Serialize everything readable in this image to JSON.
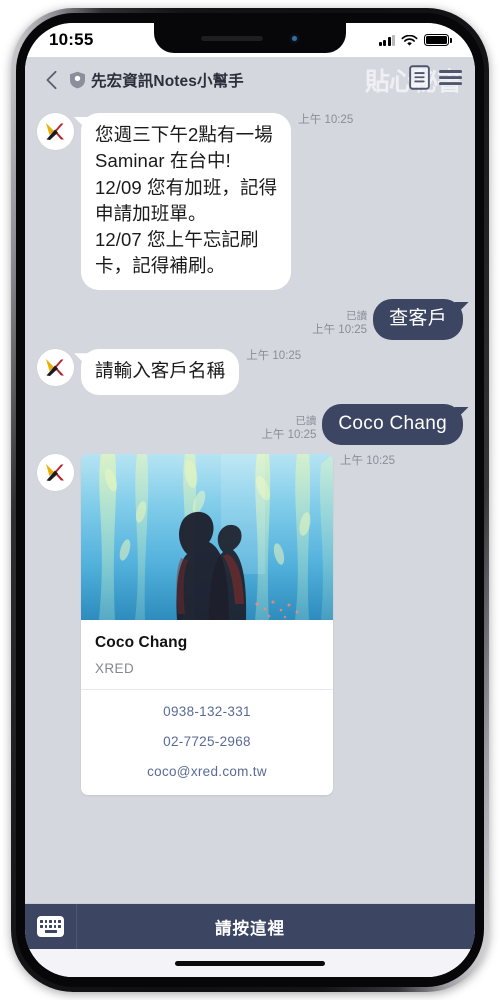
{
  "status_bar": {
    "time": "10:55",
    "signal_icon": "signal-bars-icon",
    "wifi_icon": "wifi-icon",
    "battery_icon": "battery-full-icon"
  },
  "header": {
    "back_icon": "chevron-left-icon",
    "verified_icon": "shield-check-icon",
    "title": "先宏資訊Notes小幫手",
    "ghost_text": "貼心秘書",
    "notes_icon": "document-notes-icon",
    "menu_icon": "hamburger-menu-icon"
  },
  "messages": [
    {
      "id": "bot-reminder",
      "direction": "incoming",
      "avatar_icon": "xred-logo-avatar",
      "text": "您週三下午2點有一場Saminar 在台中!\n12/09 您有加班，記得申請加班單。\n12/07 您上午忘記刷卡，記得補刷。",
      "lines": [
        "您週三下午2點有一場",
        "Saminar 在台中!",
        "12/09 您有加班，記得",
        "申請加班單。",
        "12/07 您上午忘記刷",
        "卡，記得補刷。"
      ],
      "time": "上午 10:25"
    },
    {
      "id": "user-query-customer",
      "direction": "outgoing",
      "text": "查客戶",
      "read_label": "已讀",
      "time": "上午 10:25"
    },
    {
      "id": "bot-prompt-name",
      "direction": "incoming",
      "avatar_icon": "xred-logo-avatar",
      "text": "請輸入客戶名稱",
      "time": "上午 10:25"
    },
    {
      "id": "user-customer-name",
      "direction": "outgoing",
      "text": "Coco Chang",
      "read_label": "已讀",
      "time": "上午 10:25"
    }
  ],
  "contact_card": {
    "avatar_icon": "xred-logo-avatar",
    "photo_alt": "aquarium-silhouette-photo",
    "name": "Coco Chang",
    "company": "XRED",
    "links": [
      {
        "label": "0938-132-331",
        "icon": "mobile-phone-link"
      },
      {
        "label": "02-7725-2968",
        "icon": "telephone-link"
      },
      {
        "label": "coco@xred.com.tw",
        "icon": "email-link"
      }
    ],
    "time": "上午 10:25"
  },
  "bottom_bar": {
    "keyboard_icon": "keyboard-icon",
    "label": "請按這裡"
  },
  "colors": {
    "chat_background": "#d5d7df",
    "outgoing_bubble": "#3c4663",
    "incoming_bubble": "#ffffff",
    "bottom_bar": "#3c4663",
    "link_text": "#5a6a96",
    "meta_text": "#8a8d98"
  }
}
